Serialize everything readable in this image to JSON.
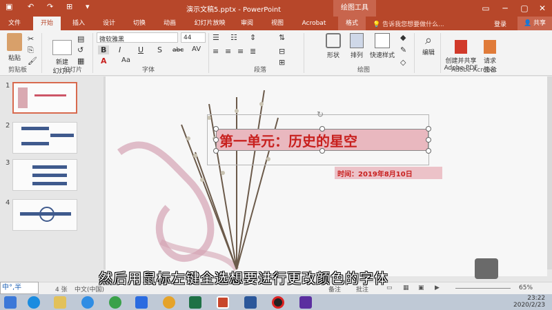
{
  "window": {
    "title": "演示文稿5.pptx - PowerPoint",
    "drawing_tools": "绘图工具"
  },
  "tabs": [
    {
      "label": "文件"
    },
    {
      "label": "开始"
    },
    {
      "label": "插入"
    },
    {
      "label": "设计"
    },
    {
      "label": "切换"
    },
    {
      "label": "动画"
    },
    {
      "label": "幻灯片放映"
    },
    {
      "label": "审阅"
    },
    {
      "label": "视图"
    },
    {
      "label": "Acrobat"
    },
    {
      "label": "格式"
    }
  ],
  "tell_me": "告诉我您想要做什么...",
  "login": "登录",
  "share": "共享",
  "ribbon": {
    "paste": "粘贴",
    "clipboard": "剪贴板",
    "new_slide": "新建\n幻灯片",
    "slides": "幻灯片",
    "font_name": "微软雅黑",
    "font_size": "44",
    "font": "字体",
    "paragraph": "段落",
    "shape": "形状",
    "arrange": "排列",
    "quick_style": "快速样式",
    "drawing": "绘图",
    "edit": "编辑",
    "create_pdf": "创建并共享\nAdobe PDF",
    "request_sign": "请求\n签名",
    "adobe_acrobat": "Adobe Acrobat"
  },
  "slides": [
    {
      "num": "1"
    },
    {
      "num": "2"
    },
    {
      "num": "3"
    },
    {
      "num": "4"
    }
  ],
  "slide": {
    "title": "第一单元：历史的星空",
    "date": "时间：2019年8月10日"
  },
  "caption": "然后用鼠标左键全选想要进行更改颜色的字体",
  "status": {
    "ime": "中°,半",
    "slide_count": "4 张",
    "lang": "中文(中国)",
    "notes": "备注",
    "comments": "批注",
    "zoom": "65%"
  },
  "clock": {
    "time": "23:22",
    "date": "2020/2/23"
  },
  "colors": {
    "accent": "#b7472a",
    "title_red": "#c8201e"
  }
}
